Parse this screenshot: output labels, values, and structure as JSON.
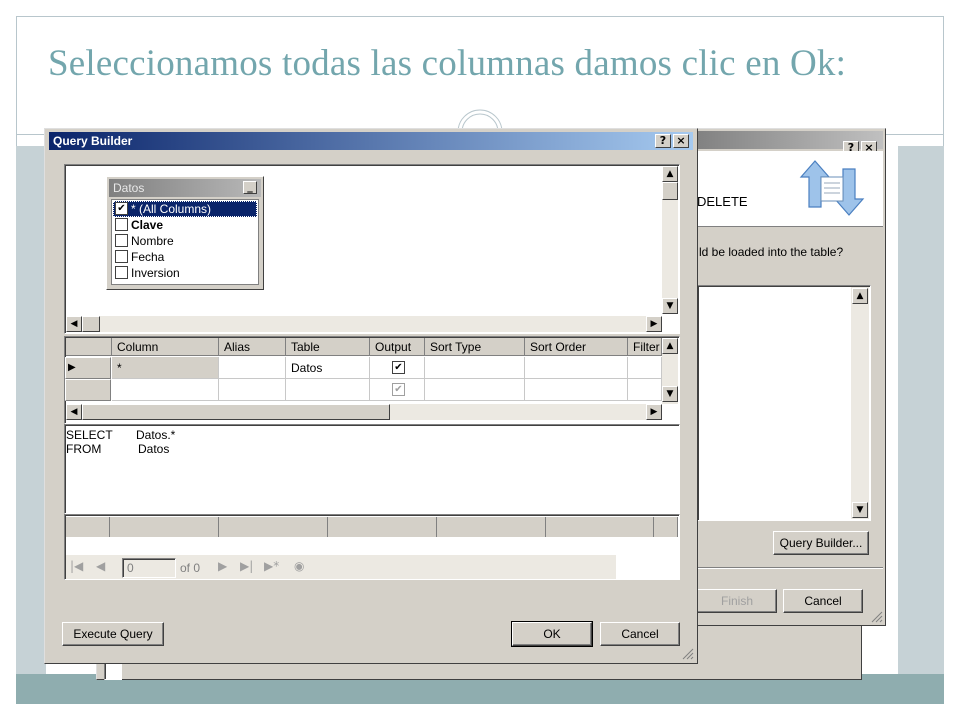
{
  "slide": {
    "title": "Seleccionamos todas las columnas damos clic en Ok:"
  },
  "back_dialog": {
    "help_label": "?",
    "close_label": "×",
    "delete_text": "DELETE",
    "question_text": "ld be loaded into the table?",
    "query_builder_button": "Query Builder...",
    "finish_button": "Finish",
    "cancel_button": "Cancel"
  },
  "query_builder": {
    "title": "Query Builder",
    "help_label": "?",
    "close_label": "×",
    "table_box": {
      "title": "Datos",
      "minimize_label": "_",
      "columns": [
        {
          "label": "* (All Columns)",
          "checked": "✔"
        },
        {
          "label": "Clave",
          "checked": ""
        },
        {
          "label": "Nombre",
          "checked": ""
        },
        {
          "label": "Fecha",
          "checked": ""
        },
        {
          "label": "Inversion",
          "checked": ""
        }
      ]
    },
    "grid": {
      "headers": [
        "Column",
        "Alias",
        "Table",
        "Output",
        "Sort Type",
        "Sort Order",
        "Filter"
      ],
      "rows": [
        {
          "column": "*",
          "alias": "",
          "table": "Datos",
          "output": "✔"
        },
        {
          "column": "",
          "alias": "",
          "table": "",
          "output": "✔"
        }
      ],
      "row_indicator": "▶"
    },
    "sql": {
      "select_kw": "SELECT",
      "select_val": "Datos.*",
      "from_kw": "FROM",
      "from_val": "Datos"
    },
    "navigator": {
      "position_value": "0",
      "of_text": "of 0"
    },
    "execute_button": "Execute Query",
    "ok_button": "OK",
    "cancel_button": "Cancel"
  },
  "colors": {
    "title": "#73a6ad",
    "titlebar_active": "#0a246a",
    "dialog_face": "#d4d0c8",
    "accent_band": "#8fadaf"
  },
  "icons": [
    "refresh-arrows-icon",
    "minimize-icon",
    "help-icon",
    "close-icon",
    "scroll-up-icon",
    "scroll-down-icon",
    "scroll-left-icon",
    "scroll-right-icon",
    "first-record-icon",
    "previous-record-icon",
    "next-record-icon",
    "last-record-icon",
    "new-record-icon",
    "stop-icon",
    "row-indicator-icon",
    "resize-grip-icon"
  ]
}
